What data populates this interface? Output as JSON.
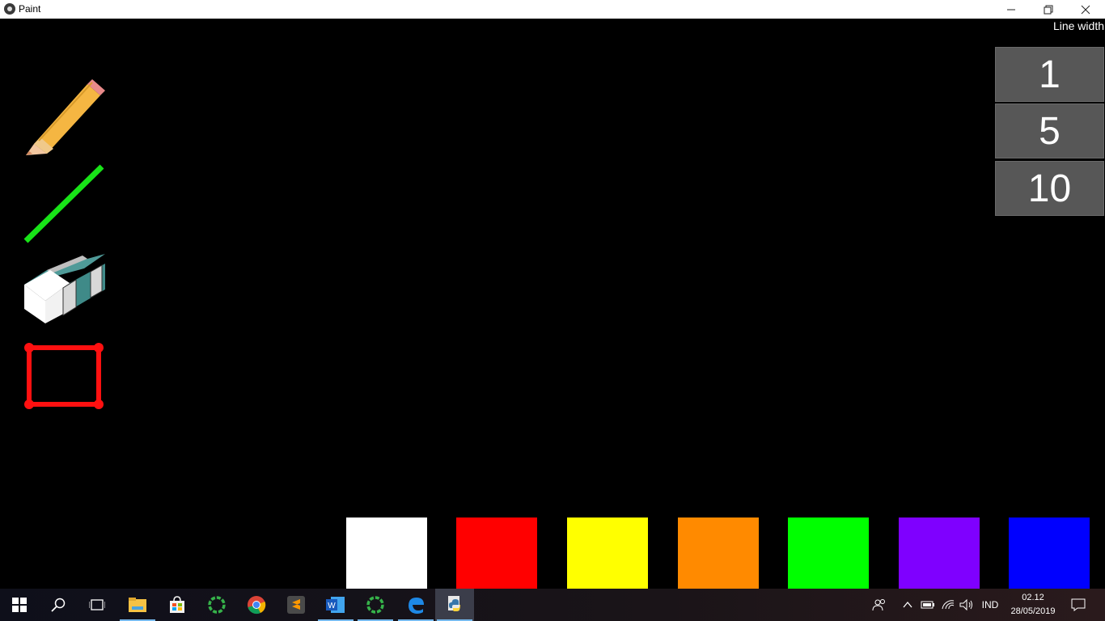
{
  "window": {
    "title": "Paint",
    "min_glyph": "—",
    "max_glyph": "❐",
    "close_glyph": "✕"
  },
  "tools": [
    {
      "name": "pencil-icon"
    },
    {
      "name": "line-icon"
    },
    {
      "name": "eraser-icon"
    },
    {
      "name": "rectangle-icon"
    }
  ],
  "line_width": {
    "label": "Line width",
    "options": [
      "1",
      "5",
      "10"
    ]
  },
  "palette": [
    "#ffffff",
    "#ff0000",
    "#ffff00",
    "#ff8a00",
    "#00ff00",
    "#7f00ff",
    "#0000ff"
  ],
  "taskbar": {
    "language": "IND",
    "time": "02.12",
    "date": "28/05/2019"
  }
}
